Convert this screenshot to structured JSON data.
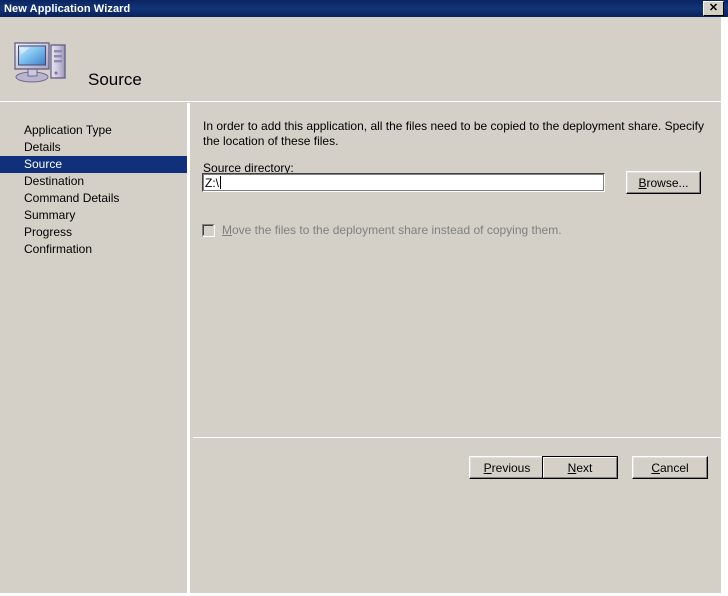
{
  "window": {
    "title": "New Application Wizard",
    "close_label": "✕"
  },
  "header": {
    "title": "Source",
    "icon": "computer-icon"
  },
  "sidebar": {
    "items": [
      {
        "label": "Application Type",
        "selected": false
      },
      {
        "label": "Details",
        "selected": false
      },
      {
        "label": "Source",
        "selected": true
      },
      {
        "label": "Destination",
        "selected": false
      },
      {
        "label": "Command Details",
        "selected": false
      },
      {
        "label": "Summary",
        "selected": false
      },
      {
        "label": "Progress",
        "selected": false
      },
      {
        "label": "Confirmation",
        "selected": false
      }
    ]
  },
  "content": {
    "instruction": "In order to add this application, all the files need to be copied to the deployment share.  Specify the location of these files.",
    "source_directory": {
      "label_prefix": "S",
      "label_rest": "ource directory:",
      "value": "Z:\\"
    },
    "browse_button": {
      "accel": "B",
      "rest": "rowse..."
    },
    "move_checkbox": {
      "accel": "M",
      "rest": "ove the files to the deployment share instead of copying them.",
      "checked": false,
      "enabled": false
    }
  },
  "footer": {
    "previous": {
      "accel": "P",
      "rest": "revious"
    },
    "next": {
      "accel": "N",
      "rest": "ext"
    },
    "cancel": {
      "accel": "C",
      "rest": "ancel"
    }
  },
  "colors": {
    "titlebar": "#10307b",
    "face": "#d4d0c8",
    "selection": "#10307b",
    "disabled_text": "#808080"
  }
}
